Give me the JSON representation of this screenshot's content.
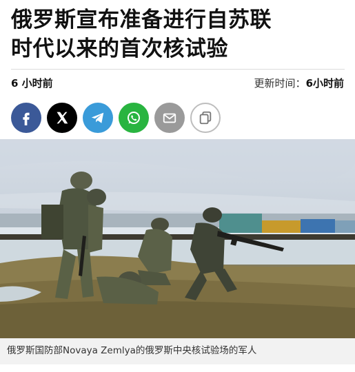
{
  "article": {
    "headline_line1": "俄罗斯宣布准备进行自苏联",
    "headline_line2": "时代以来的首次核试验",
    "published": "6 小时前",
    "updated_label": "更新时间：",
    "updated_value": "6小时前"
  },
  "share": {
    "buttons": [
      {
        "icon": "facebook-icon",
        "color": "#3b5998"
      },
      {
        "icon": "x-icon",
        "color": "#000000"
      },
      {
        "icon": "telegram-icon",
        "color": "#3a9bd9"
      },
      {
        "icon": "whatsapp-icon",
        "color": "#29b440"
      },
      {
        "icon": "mail-icon",
        "color": "#9a9a9a"
      },
      {
        "icon": "copy-link-icon",
        "color": "#ffffff"
      }
    ]
  },
  "photo": {
    "caption": "俄罗斯国防部Novaya Zemlya的俄罗斯中央核试验场的军人"
  }
}
